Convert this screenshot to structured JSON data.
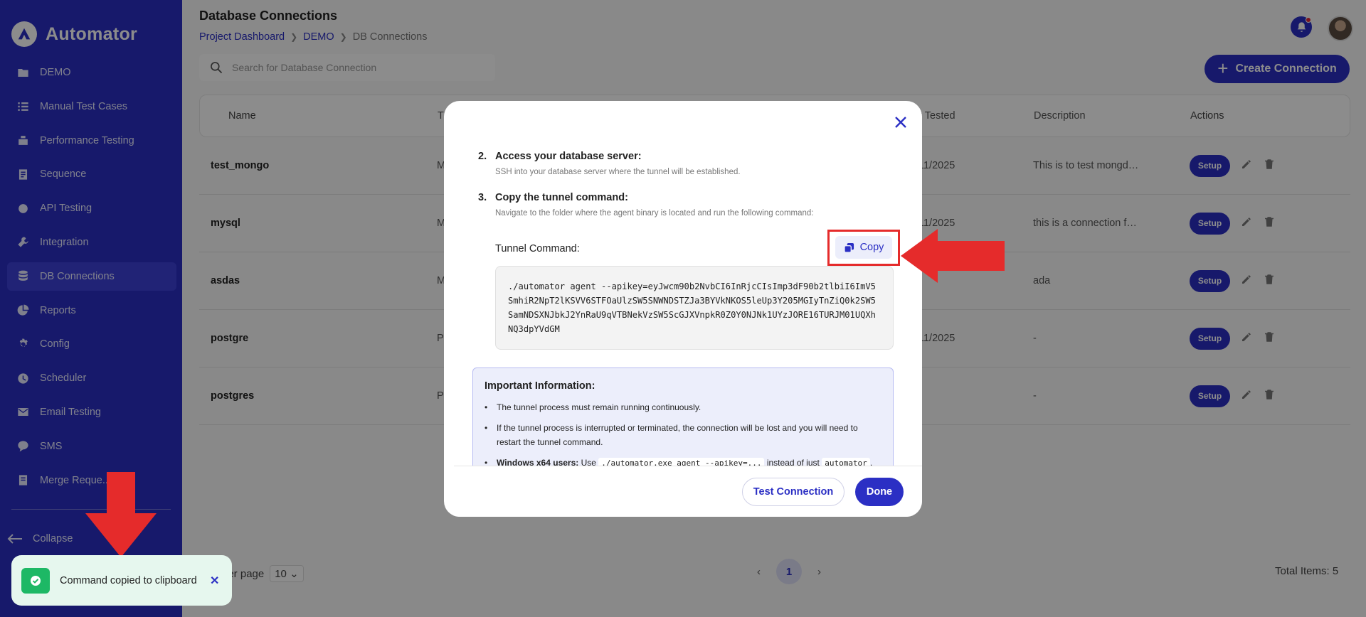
{
  "app": {
    "name": "Automator"
  },
  "sidebar": {
    "items": [
      {
        "label": "DEMO",
        "icon": "folder-icon"
      },
      {
        "label": "Manual Test Cases",
        "icon": "list-icon"
      },
      {
        "label": "Performance Testing",
        "icon": "gauge-icon"
      },
      {
        "label": "Sequence",
        "icon": "document-icon"
      },
      {
        "label": "API Testing",
        "icon": "api-icon"
      },
      {
        "label": "Integration",
        "icon": "wrench-icon"
      },
      {
        "label": "DB Connections",
        "icon": "database-icon"
      },
      {
        "label": "Reports",
        "icon": "pie-chart-icon"
      },
      {
        "label": "Config",
        "icon": "settings-icon"
      },
      {
        "label": "Scheduler",
        "icon": "clock-icon"
      },
      {
        "label": "Email Testing",
        "icon": "mail-icon"
      },
      {
        "label": "SMS",
        "icon": "chat-icon"
      },
      {
        "label": "Merge Reque...",
        "icon": "merge-icon"
      }
    ],
    "active_index": 6,
    "collapse_label": "Collapse"
  },
  "header": {
    "title": "Database Connections",
    "breadcrumb": [
      "Project Dashboard",
      "DEMO",
      "DB Connections"
    ]
  },
  "search": {
    "placeholder": "Search for Database Connection"
  },
  "create_button": "Create Connection",
  "table": {
    "columns": {
      "name": "Name",
      "type": "T",
      "tested": "t Tested",
      "description": "Description",
      "actions": "Actions"
    },
    "rows": [
      {
        "name": "test_mongo",
        "type": "M",
        "tested": "11/2025",
        "description": "This is to test mongdb c..."
      },
      {
        "name": "mysql",
        "type": "M",
        "tested": "11/2025",
        "description": "this is a connection for ..."
      },
      {
        "name": "asdas",
        "type": "M",
        "tested": "",
        "description": "ada"
      },
      {
        "name": "postgre",
        "type": "P",
        "tested": "11/2025",
        "description": "-"
      },
      {
        "name": "postgres",
        "type": "P",
        "tested": "",
        "description": "-"
      }
    ],
    "setup_label": "Setup"
  },
  "pagination": {
    "per_page_label": "per page",
    "per_page_value": "10",
    "current_page": "1",
    "total": "Total Items: 5"
  },
  "modal": {
    "steps": [
      {
        "num": "2.",
        "title": "Access your database server:",
        "desc": "SSH into your database server where the tunnel will be established."
      },
      {
        "num": "3.",
        "title": "Copy the tunnel command:",
        "desc": "Navigate to the folder where the agent binary is located and run the following command:"
      }
    ],
    "tunnel_label": "Tunnel Command:",
    "copy_label": "Copy",
    "command": "./automator agent --apikey=eyJwcm90b2NvbCI6InRjcCIsImp3dF90b2tlbiI6ImV5SmhiR2NpT2lKSVV6STFOaUlzSW5SNWNDSTZJa3BYVkNKOS5leUp3Y205MGIyTnZiQ0k2SW5SamNDSXNJbkJ2YnRaU9qVTBNekVzSW5ScGJXVnpkR0Z0Y0NJNk1UYzJORE16TURJM01UQXhNQ3dpYVdGM",
    "info_title": "Important Information:",
    "info_items": [
      "The tunnel process must remain running continuously.",
      "If the tunnel process is interrupted or terminated, the connection will be lost and you will need to restart the tunnel command."
    ],
    "windows_note": {
      "bold": "Windows x64 users:",
      "pre": "Use",
      "code1": "./automator.exe agent --apikey=...",
      "mid": "instead of just",
      "code2": "automator",
      "post": "."
    },
    "test_button": "Test Connection",
    "done_button": "Done"
  },
  "toast": {
    "message": "Command copied to clipboard"
  },
  "colors": {
    "brand": "#2b2fc4",
    "annotation_red": "#e52b2b",
    "success": "#1db865"
  }
}
